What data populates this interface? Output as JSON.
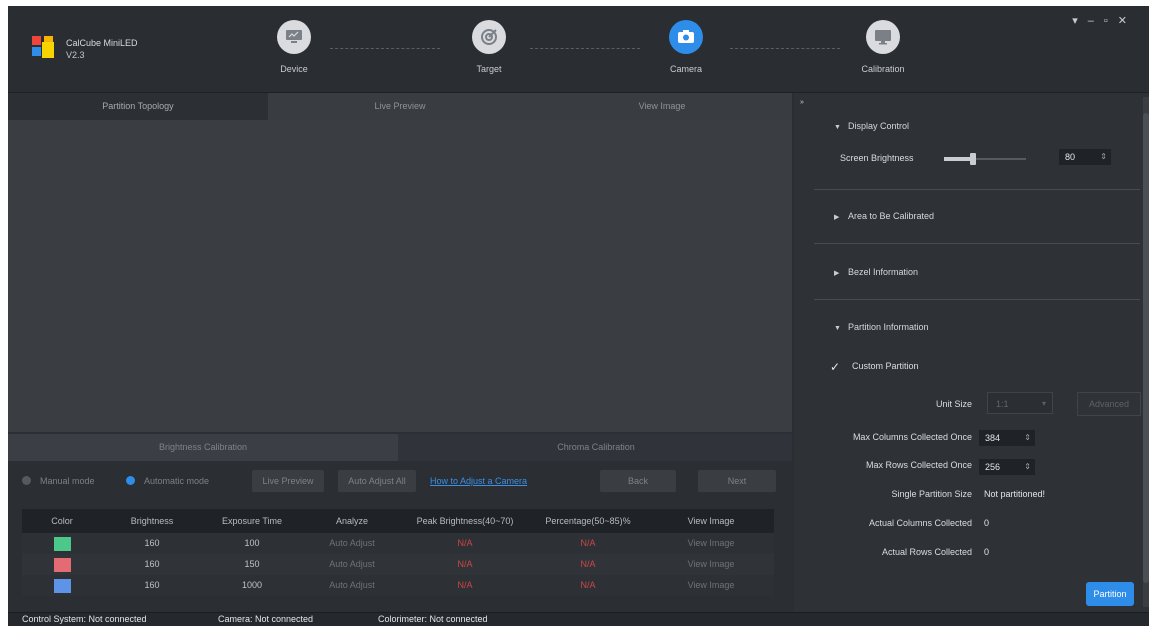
{
  "app": {
    "name": "CalCube MiniLED",
    "version": "V2.3"
  },
  "window_controls": {
    "menu": "▾",
    "minimize": "–",
    "maximize": "▫",
    "close": "✕"
  },
  "steps": [
    {
      "label": "Device",
      "icon": "monitor-icon"
    },
    {
      "label": "Target",
      "icon": "target-icon"
    },
    {
      "label": "Camera",
      "icon": "camera-icon",
      "active": true
    },
    {
      "label": "Calibration",
      "icon": "display-icon"
    }
  ],
  "tabs": [
    {
      "label": "Partition Topology",
      "active": true
    },
    {
      "label": "Live Preview"
    },
    {
      "label": "View Image"
    }
  ],
  "calibration_tabs": [
    {
      "label": "Brightness Calibration",
      "active": true
    },
    {
      "label": "Chroma Calibration"
    }
  ],
  "modes": {
    "manual": "Manual mode",
    "automatic": "Automatic mode",
    "selected": "automatic"
  },
  "buttons": {
    "live_preview": "Live Preview",
    "auto_adjust_all": "Auto Adjust All",
    "how_to": "How to Adjust a Camera",
    "back": "Back",
    "next": "Next",
    "advanced": "Advanced",
    "partition": "Partition"
  },
  "table": {
    "headers": [
      "Color",
      "Brightness",
      "Exposure Time",
      "Analyze",
      "Peak Brightness(40~70)",
      "Percentage(50~85)%",
      "View Image"
    ],
    "rows": [
      {
        "color": "#4cc98a",
        "brightness": "160",
        "exposure": "100",
        "analyze": "Auto Adjust",
        "peak": "N/A",
        "percentage": "N/A",
        "view": "View Image"
      },
      {
        "color": "#e46b74",
        "brightness": "160",
        "exposure": "150",
        "analyze": "Auto Adjust",
        "peak": "N/A",
        "percentage": "N/A",
        "view": "View Image"
      },
      {
        "color": "#5d94e8",
        "brightness": "160",
        "exposure": "1000",
        "analyze": "Auto Adjust",
        "peak": "N/A",
        "percentage": "N/A",
        "view": "View Image"
      }
    ]
  },
  "panel": {
    "collapse_glyph": "»",
    "display_control": {
      "title": "Display Control",
      "screen_brightness_label": "Screen Brightness",
      "screen_brightness_value": "80",
      "slider_fraction": 0.35
    },
    "area_title": "Area to Be Calibrated",
    "bezel_title": "Bezel Information",
    "partition": {
      "title": "Partition Information",
      "custom_partition_label": "Custom Partition",
      "custom_partition_checked": true,
      "unit_size_label": "Unit Size",
      "unit_size_value": "1:1",
      "max_columns_label": "Max Columns Collected Once",
      "max_columns_value": "384",
      "max_rows_label": "Max Rows Collected Once",
      "max_rows_value": "256",
      "single_partition_label": "Single Partition Size",
      "single_partition_value": "Not partitioned!",
      "actual_columns_label": "Actual Columns Collected",
      "actual_columns_value": "0",
      "actual_rows_label": "Actual Rows Collected",
      "actual_rows_value": "0"
    }
  },
  "status": {
    "control_system": "Control System:  Not connected",
    "camera": "Camera:  Not connected",
    "colorimeter": "Colorimeter:  Not connected"
  },
  "colors": {
    "accent": "#2f8dea",
    "error": "#d04545",
    "background": "#2b2f34"
  }
}
